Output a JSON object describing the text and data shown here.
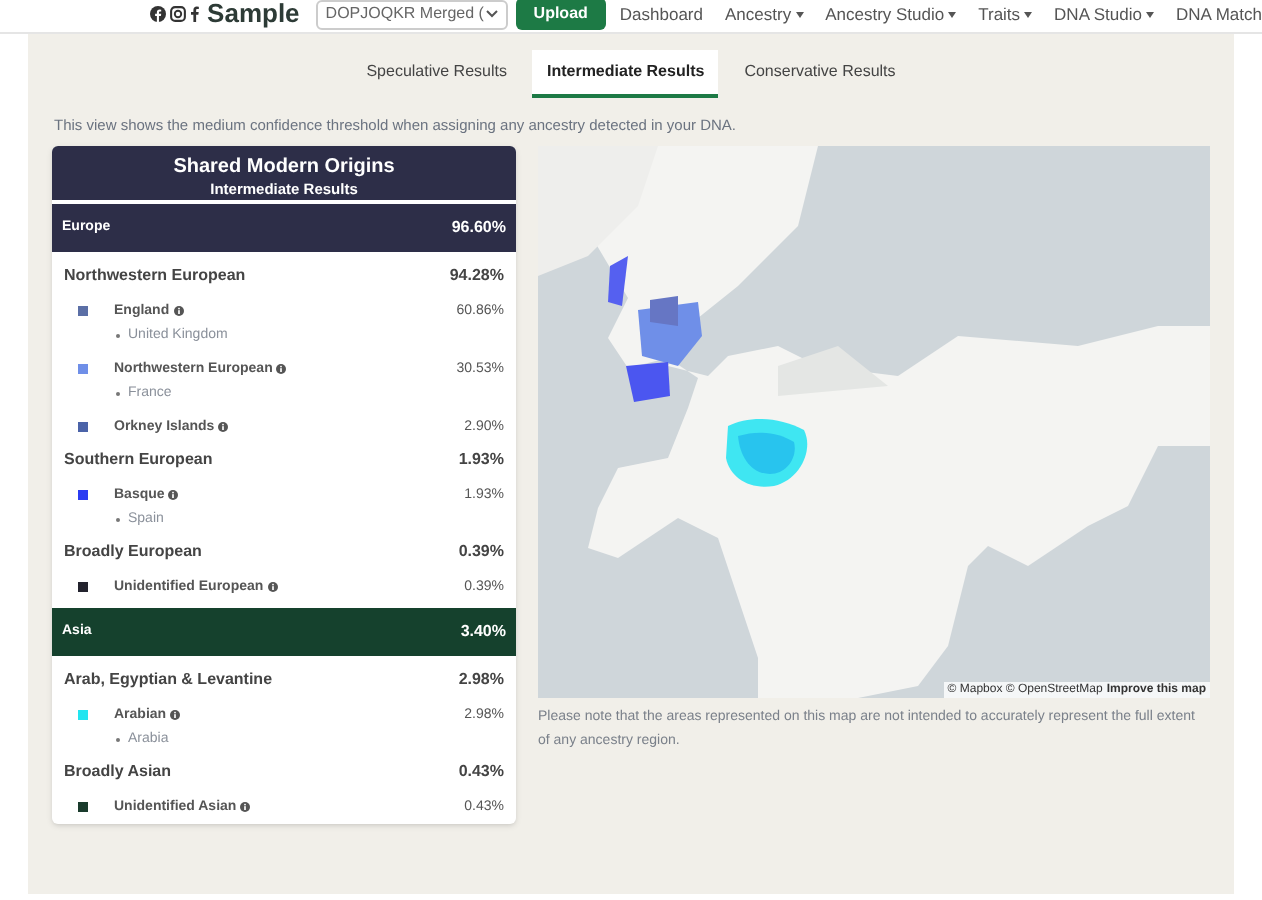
{
  "header": {
    "brand": "Sample",
    "kit_select": "DOPJOQKR Merged (",
    "upload_button": "Upload",
    "nav": [
      {
        "label": "Dashboard",
        "dropdown": false
      },
      {
        "label": "Ancestry",
        "dropdown": true
      },
      {
        "label": "Ancestry Studio",
        "dropdown": true
      },
      {
        "label": "Traits",
        "dropdown": true
      },
      {
        "label": "DNA Studio",
        "dropdown": true
      },
      {
        "label": "DNA Match",
        "dropdown": false
      }
    ]
  },
  "tabs": [
    {
      "label": "Speculative Results",
      "selected": false
    },
    {
      "label": "Intermediate Results",
      "selected": true
    },
    {
      "label": "Conservative Results",
      "selected": false
    }
  ],
  "description": "This view shows the medium confidence threshold when assigning any ancestry detected in your DNA.",
  "card": {
    "title": "Shared Modern Origins",
    "subtitle": "Intermediate Results",
    "regions": [
      {
        "name": "Europe",
        "percent": "96.60%",
        "color": "#2d2e48",
        "groups": [
          {
            "name": "Northwestern European",
            "percent": "94.28%",
            "items": [
              {
                "name": "England",
                "percent": "60.86%",
                "color": "#5b6fa6",
                "locations": [
                  "United Kingdom"
                ]
              },
              {
                "name": "Northwestern European",
                "percent": "30.53%",
                "color": "#6f8fe8",
                "locations": [
                  "France"
                ]
              },
              {
                "name": "Orkney Islands",
                "percent": "2.90%",
                "color": "#4b63a8"
              }
            ]
          },
          {
            "name": "Southern European",
            "percent": "1.93%",
            "items": [
              {
                "name": "Basque",
                "percent": "1.93%",
                "color": "#2b3cf2",
                "locations": [
                  "Spain"
                ]
              }
            ]
          },
          {
            "name": "Broadly European",
            "percent": "0.39%",
            "items": [
              {
                "name": "Unidentified European",
                "percent": "0.39%",
                "color": "#23232e"
              }
            ]
          }
        ]
      },
      {
        "name": "Asia",
        "percent": "3.40%",
        "color": "#15412d",
        "groups": [
          {
            "name": "Arab, Egyptian & Levantine",
            "percent": "2.98%",
            "items": [
              {
                "name": "Arabian",
                "percent": "2.98%",
                "color": "#22e5f0",
                "locations": [
                  "Arabia"
                ]
              }
            ]
          },
          {
            "name": "Broadly Asian",
            "percent": "0.43%",
            "items": [
              {
                "name": "Unidentified Asian",
                "percent": "0.43%",
                "color": "#1a3b2c"
              }
            ]
          }
        ]
      }
    ]
  },
  "map": {
    "attribution": "© Mapbox © OpenStreetMap",
    "improve_link": "Improve this map"
  },
  "map_note": "Please note that the areas represented on this map are not intended to accurately represent the full extent of any ancestry region."
}
